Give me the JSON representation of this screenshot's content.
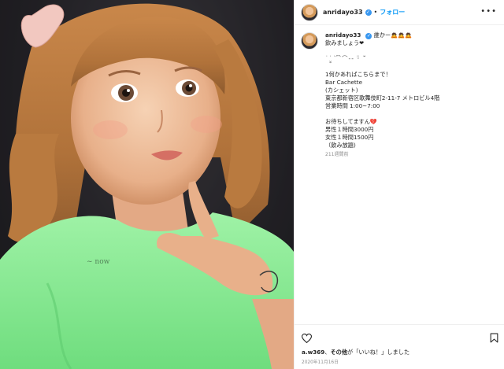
{
  "post": {
    "username": "anridayo33",
    "verified_mark": "✓",
    "separator": "•",
    "follow_label": "フォロー",
    "more_icon": "more-horizontal-icon"
  },
  "caption": {
    "username": "anridayo33",
    "lines": [
      "誰かー🙇🙇🙇",
      "飲みましょう❤",
      "",
      "˙˙̮̮˙ ᷇ ᷆⌒-- ᵕ̈ ˘̈ ",
      "",
      "1何かあればこちらまで！",
      "Bar Cachette",
      "(カシェット)",
      "東京都新宿区歌舞伎町2-11-7 メトロビル4階",
      "営業時間 1:00~7:00",
      "",
      "お待ちしてますん💔",
      "男性１時間3000円",
      "女性１時間1500円",
      "（飲み放題)"
    ],
    "time_ago": "211週間前"
  },
  "actions": {
    "like_icon": "heart-icon",
    "save_icon": "bookmark-icon"
  },
  "likes": {
    "user": "a.w369",
    "and_others": "その他",
    "suffix": "が「いいね！」しました"
  },
  "date": "2020年11月16日"
}
